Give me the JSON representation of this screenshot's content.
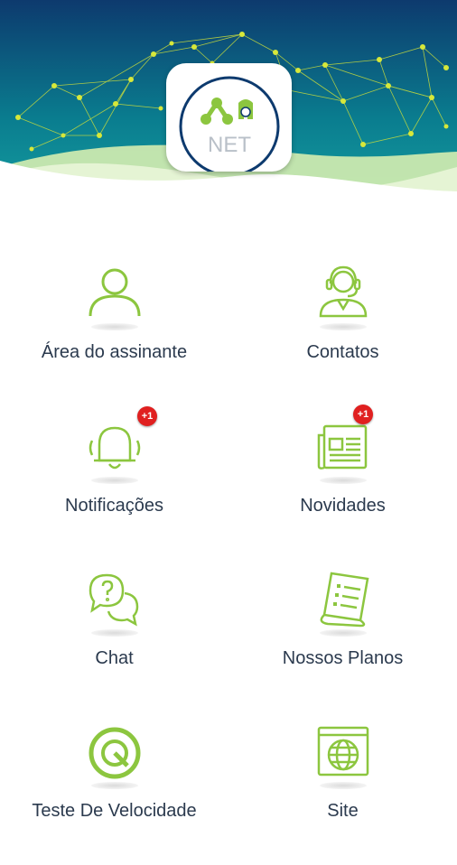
{
  "brand": {
    "logo_text": "NET",
    "primary_color": "#8cc63f",
    "header_top_color": "#0d3a6e",
    "header_mid_color": "#0a7d8f",
    "text_color": "#2b3a4e"
  },
  "menu": [
    {
      "label": "Área do assinante",
      "icon": "user-icon",
      "badge": ""
    },
    {
      "label": "Contatos",
      "icon": "headset-agent-icon",
      "badge": ""
    },
    {
      "label": "Notificações",
      "icon": "bell-icon",
      "badge": "+1"
    },
    {
      "label": "Novidades",
      "icon": "newspaper-icon",
      "badge": "+1"
    },
    {
      "label": "Chat",
      "icon": "chat-bubbles-icon",
      "badge": ""
    },
    {
      "label": "Nossos Planos",
      "icon": "document-list-icon",
      "badge": ""
    },
    {
      "label": "Teste De Velocidade",
      "icon": "speedometer-icon",
      "badge": ""
    },
    {
      "label": "Site",
      "icon": "globe-browser-icon",
      "badge": ""
    }
  ]
}
